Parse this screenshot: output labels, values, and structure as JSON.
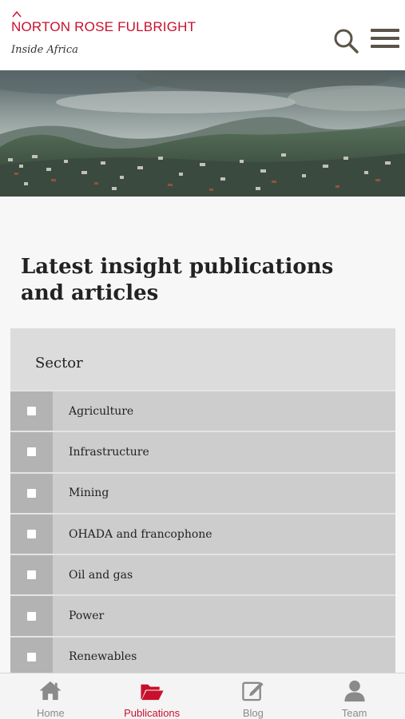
{
  "header": {
    "logo_text": "NORTON ROSE FULBRIGHT",
    "tagline": "Inside Africa",
    "brand_color": "#c8102e",
    "search_icon": "search-icon",
    "menu_icon": "hamburger-menu-icon"
  },
  "hero": {
    "image": "landscape-town-photo"
  },
  "main": {
    "title": "Latest insight publications and articles"
  },
  "filter": {
    "heading": "Sector",
    "items": [
      {
        "label": "Agriculture",
        "checked": false
      },
      {
        "label": "Infrastructure",
        "checked": false
      },
      {
        "label": "Mining",
        "checked": false
      },
      {
        "label": "OHADA and francophone",
        "checked": false
      },
      {
        "label": "Oil and gas",
        "checked": false
      },
      {
        "label": "Power",
        "checked": false
      },
      {
        "label": "Renewables",
        "checked": false
      }
    ]
  },
  "tabbar": {
    "active_color": "#c8102e",
    "inactive_color": "#8a8a8a",
    "tabs": [
      {
        "label": "Home",
        "icon": "home-icon",
        "active": false
      },
      {
        "label": "Publications",
        "icon": "folder-open-icon",
        "active": true
      },
      {
        "label": "Blog",
        "icon": "edit-icon",
        "active": false
      },
      {
        "label": "Team",
        "icon": "person-icon",
        "active": false
      }
    ]
  }
}
